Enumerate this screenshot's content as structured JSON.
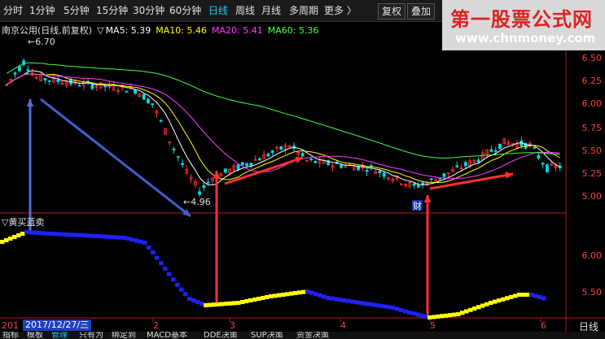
{
  "toolbar": {
    "tabs": [
      "分时",
      "1分钟",
      "5分钟",
      "15分钟",
      "30分钟",
      "60分钟",
      "日线",
      "周线",
      "月线",
      "多周期",
      "更多 〉"
    ],
    "active_tab": "日线",
    "right_buttons": [
      "复权",
      "叠加"
    ]
  },
  "watermark": {
    "title": "第一股票公式网",
    "url": "www.chnmoney.com"
  },
  "legend": {
    "name": "南京公用(日线,前复权)",
    "ma5": "MA5: 5.39",
    "ma10": "MA10: 5.46",
    "ma20": "MA20: 5.41",
    "ma60": "MA60: 5.36"
  },
  "annotations": {
    "high": "6.70",
    "low": "4.96",
    "cai": "财"
  },
  "indicator": {
    "title": "▽黄买蓝卖"
  },
  "price_axis": [
    "6.50",
    "6.25",
    "6.00",
    "5.75",
    "5.50",
    "5.25",
    "5.00"
  ],
  "ind_axis": [
    "6.00",
    "5.50"
  ],
  "x_axis": [
    "201",
    "2",
    "3",
    "4",
    "5",
    "6"
  ],
  "date": "2017/12/27/三",
  "right_label": "日线",
  "bottom_tabs": [
    "指标",
    "模板",
    "管理",
    "只有为",
    "绑定到",
    "MACD基本",
    "DDE决策",
    "SUP决策",
    "资金决策"
  ],
  "colors": {
    "up": "#ff3232",
    "down": "#00d8e8",
    "ma5": "#ffffff",
    "ma10": "#ffff00",
    "ma20": "#ff40ff",
    "ma60": "#40ff40",
    "buy": "#ffff00",
    "sell": "#2020ff"
  }
}
